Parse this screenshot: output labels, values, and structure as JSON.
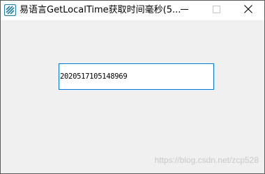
{
  "window": {
    "title": "易语言GetLocalTime获取时间毫秒(5...",
    "app_icon": "e-language-app-icon",
    "controls": {
      "minimize_icon": "minimize-icon",
      "maximize_icon": "maximize-icon",
      "close_icon": "close-icon"
    }
  },
  "edit_box": {
    "value": "2020517105148969"
  },
  "watermark": {
    "text": "https://blog.csdn.net/zcp528"
  },
  "colors": {
    "edit_border_focus": "#0078d7",
    "app_icon": "#1e7fa6",
    "background": "#f0f0f0"
  }
}
